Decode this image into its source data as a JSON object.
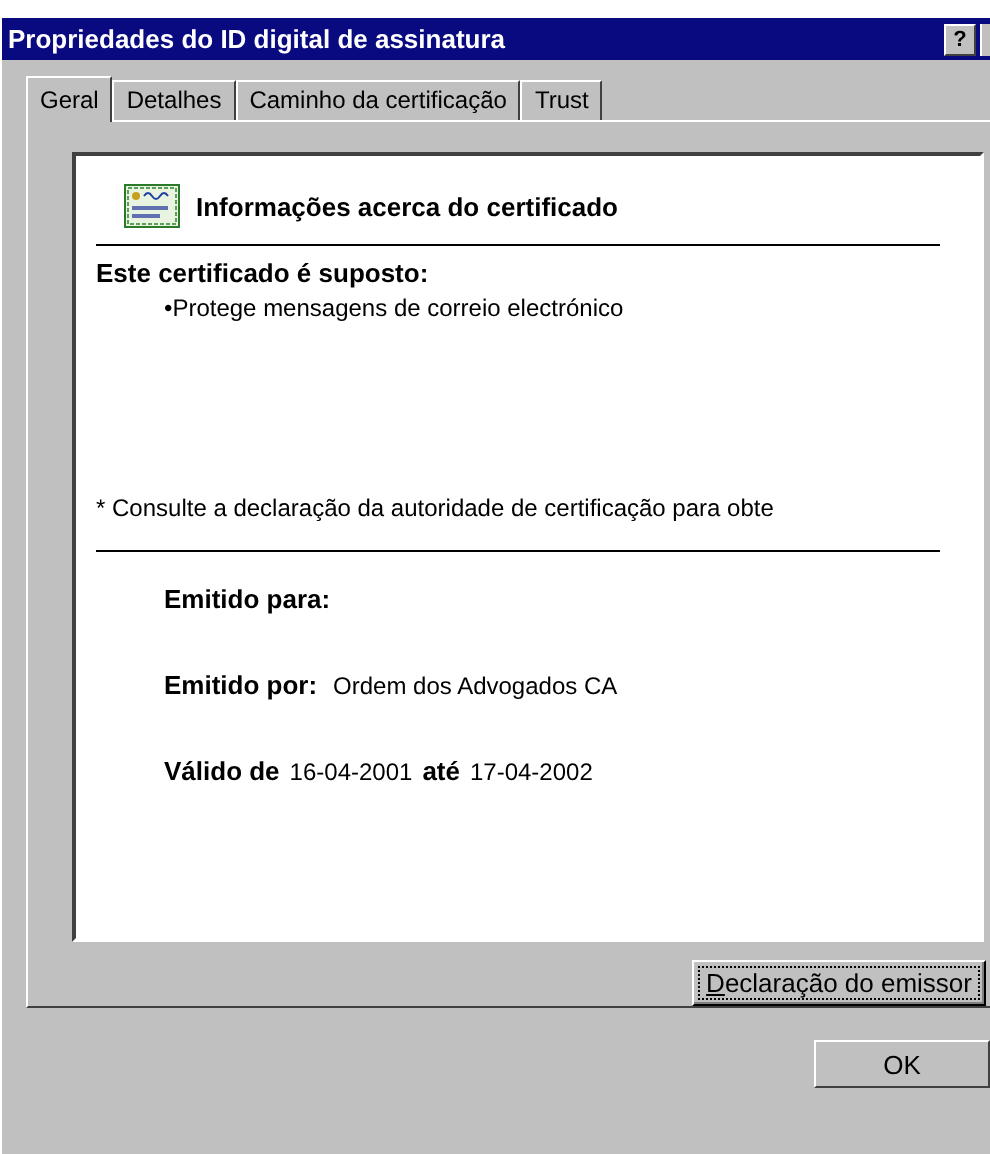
{
  "window": {
    "title": "Propriedades do ID digital de assinatura",
    "help_button": "?"
  },
  "tabs": [
    {
      "label": "Geral",
      "selected": true
    },
    {
      "label": "Detalhes",
      "selected": false
    },
    {
      "label": "Caminho da certificação",
      "selected": false
    },
    {
      "label": "Trust",
      "selected": false
    }
  ],
  "certificate": {
    "heading": "Informações acerca do certificado",
    "purpose_label": "Este certificado é suposto:",
    "purposes": [
      "•Protege mensagens de correio electrónico"
    ],
    "note": "* Consulte a declaração da autoridade de certificação para obte",
    "issued_to_label": "Emitido para:",
    "issued_by_label": "Emitido por:",
    "issued_by": "Ordem dos Advogados CA",
    "valid_from_label": "Válido de",
    "valid_from": "16-04-2001",
    "valid_to_label": "até",
    "valid_to": "17-04-2002"
  },
  "issuer_statement_button": "Declaração do emissor",
  "buttons": [
    "OK"
  ]
}
